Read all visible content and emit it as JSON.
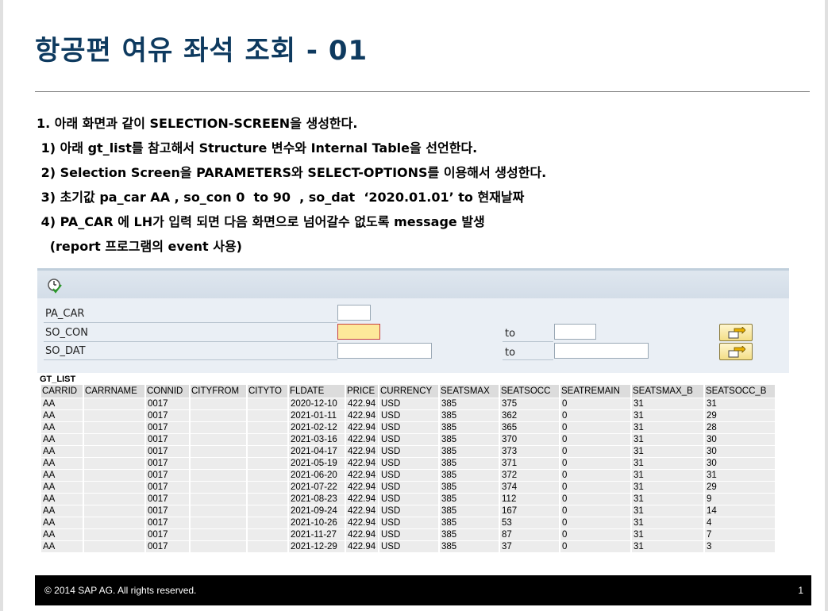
{
  "slide": {
    "title": "항공편 여유 좌석 조회 - 01",
    "instructions": [
      "1. 아래 화면과 같이 SELECTION-SCREEN을 생성한다.",
      " 1) 아래 gt_list를 참고해서 Structure 변수와 Internal Table을 선언한다.",
      " 2) Selection Screen을 PARAMETERS와 SELECT-OPTIONS를 이용해서 생성한다.",
      " 3) 초기값 pa_car AA , so_con 0  to 90  , so_dat  ‘2020.01.01’ to 현재날짜",
      " 4) PA_CAR 에 LH가 입력 되면 다음 화면으로 넘어갈수 없도록 message 발생",
      "   (report 프로그램의 event 사용)"
    ]
  },
  "selection_screen": {
    "execute_icon": "execute-clock-icon",
    "params": [
      {
        "label": "PA_CAR"
      },
      {
        "label": "SO_CON",
        "to_label": "to"
      },
      {
        "label": "SO_DAT",
        "to_label": "to"
      }
    ],
    "multiple_selection_icon": "multiple-selection-arrow-icon"
  },
  "gt_list": {
    "title": "GT_LIST",
    "columns": [
      "CARRID",
      "CARRNAME",
      "CONNID",
      "CITYFROM",
      "CITYTO",
      "FLDATE",
      "PRICE",
      "CURRENCY",
      "SEATSMAX",
      "SEATSOCC",
      "SEATREMAIN",
      "SEATSMAX_B",
      "SEATSOCC_B"
    ],
    "rows": [
      [
        "AA",
        "",
        "0017",
        "",
        "",
        "2020-12-10",
        "422.94",
        "USD",
        "385",
        "375",
        "0",
        "31",
        "31"
      ],
      [
        "AA",
        "",
        "0017",
        "",
        "",
        "2021-01-11",
        "422.94",
        "USD",
        "385",
        "362",
        "0",
        "31",
        "29"
      ],
      [
        "AA",
        "",
        "0017",
        "",
        "",
        "2021-02-12",
        "422.94",
        "USD",
        "385",
        "365",
        "0",
        "31",
        "28"
      ],
      [
        "AA",
        "",
        "0017",
        "",
        "",
        "2021-03-16",
        "422.94",
        "USD",
        "385",
        "370",
        "0",
        "31",
        "30"
      ],
      [
        "AA",
        "",
        "0017",
        "",
        "",
        "2021-04-17",
        "422.94",
        "USD",
        "385",
        "373",
        "0",
        "31",
        "30"
      ],
      [
        "AA",
        "",
        "0017",
        "",
        "",
        "2021-05-19",
        "422.94",
        "USD",
        "385",
        "371",
        "0",
        "31",
        "30"
      ],
      [
        "AA",
        "",
        "0017",
        "",
        "",
        "2021-06-20",
        "422.94",
        "USD",
        "385",
        "372",
        "0",
        "31",
        "31"
      ],
      [
        "AA",
        "",
        "0017",
        "",
        "",
        "2021-07-22",
        "422.94",
        "USD",
        "385",
        "374",
        "0",
        "31",
        "29"
      ],
      [
        "AA",
        "",
        "0017",
        "",
        "",
        "2021-08-23",
        "422.94",
        "USD",
        "385",
        "112",
        "0",
        "31",
        "9"
      ],
      [
        "AA",
        "",
        "0017",
        "",
        "",
        "2021-09-24",
        "422.94",
        "USD",
        "385",
        "167",
        "0",
        "31",
        "14"
      ],
      [
        "AA",
        "",
        "0017",
        "",
        "",
        "2021-10-26",
        "422.94",
        "USD",
        "385",
        "53",
        "0",
        "31",
        "4"
      ],
      [
        "AA",
        "",
        "0017",
        "",
        "",
        "2021-11-27",
        "422.94",
        "USD",
        "385",
        "87",
        "0",
        "31",
        "7"
      ],
      [
        "AA",
        "",
        "0017",
        "",
        "",
        "2021-12-29",
        "422.94",
        "USD",
        "385",
        "37",
        "0",
        "31",
        "3"
      ]
    ]
  },
  "footer": {
    "copyright": "©  2014 SAP AG. All rights reserved.",
    "page_number": "1"
  }
}
